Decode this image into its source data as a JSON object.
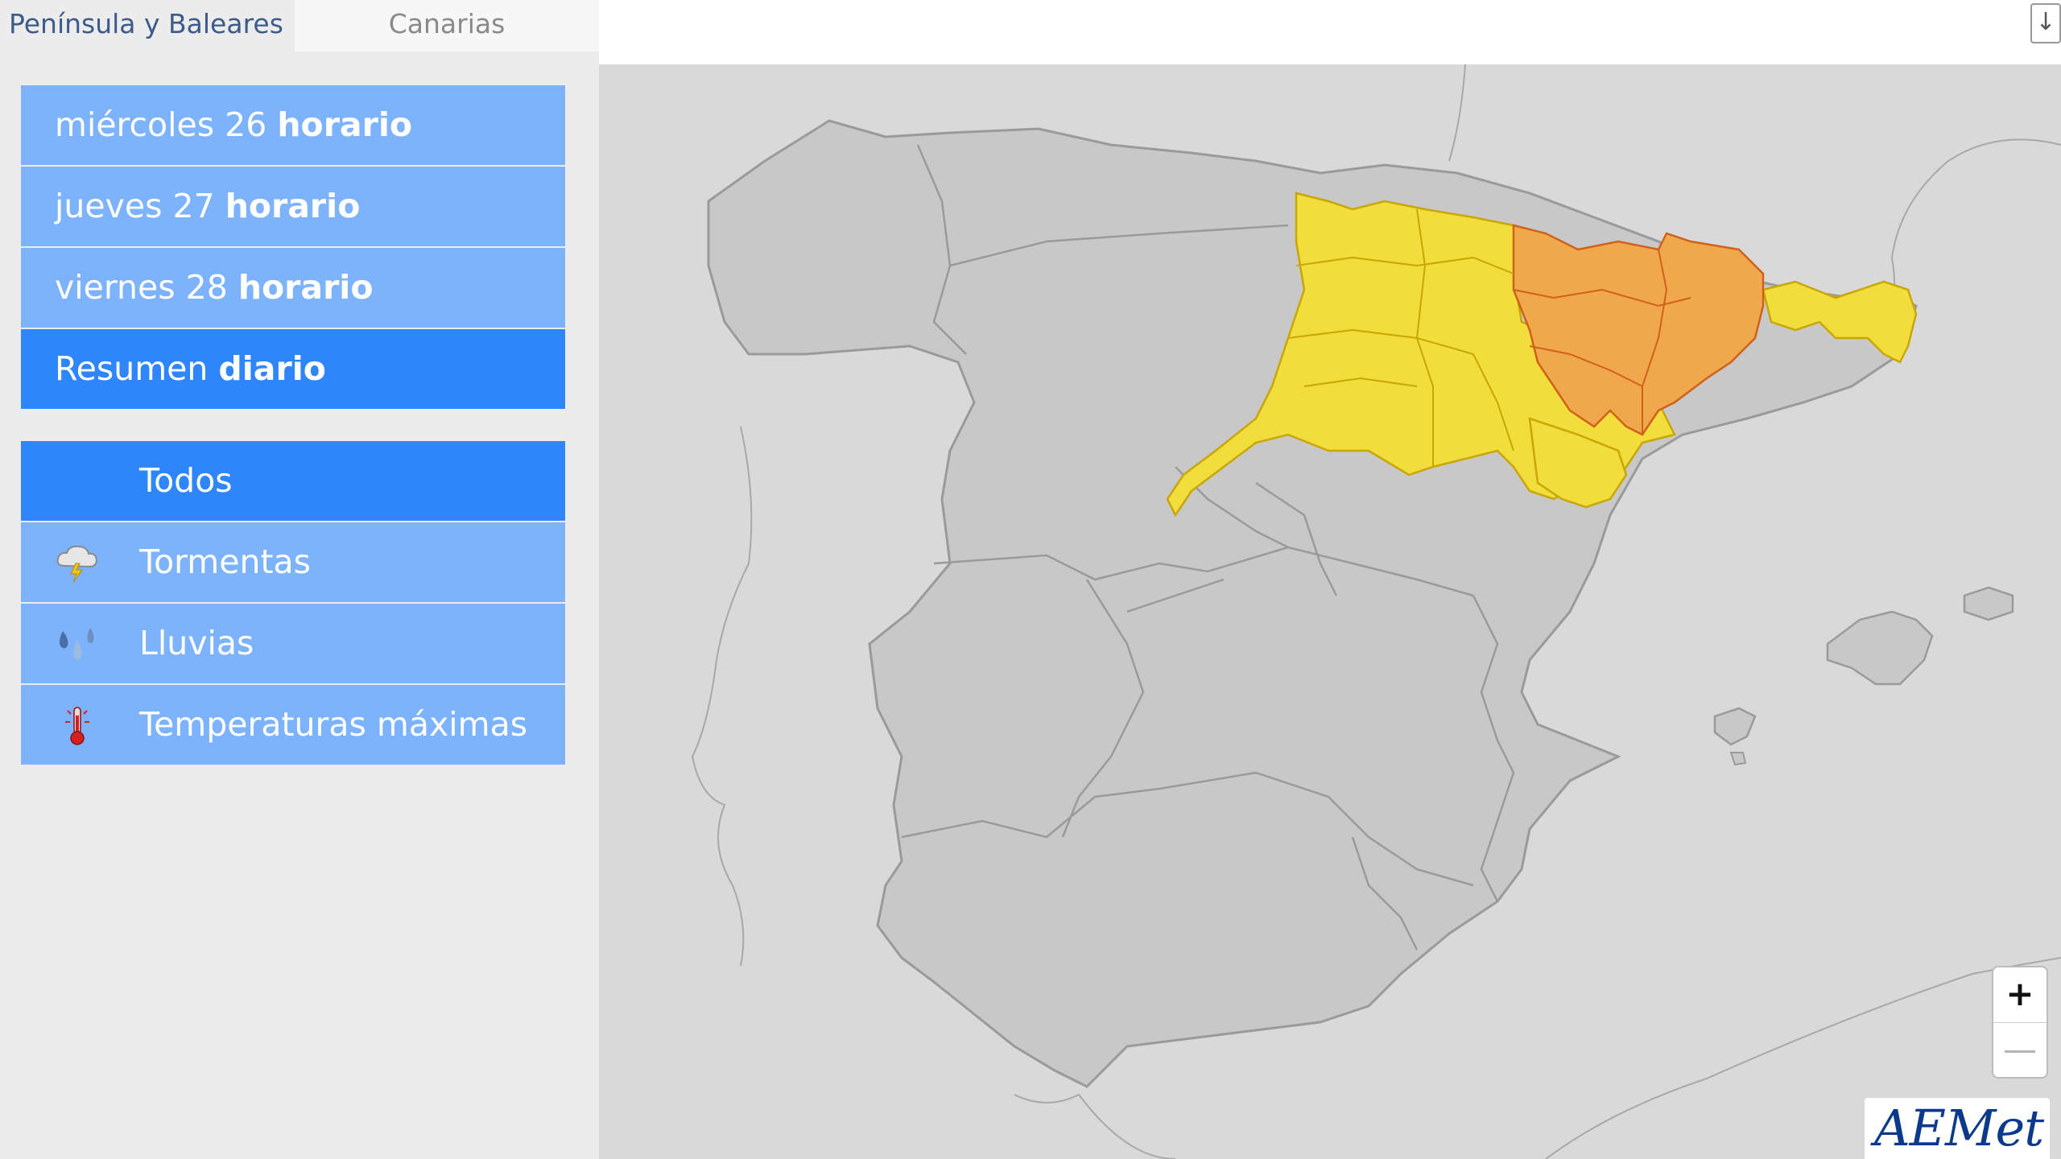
{
  "region_tabs": [
    {
      "label": "Península y Baleares",
      "active": true
    },
    {
      "label": "Canarias",
      "active": false
    }
  ],
  "day_menu": [
    {
      "prefix": "miércoles 26",
      "suffix": "horario",
      "selected": false
    },
    {
      "prefix": "jueves 27",
      "suffix": "horario",
      "selected": false
    },
    {
      "prefix": "viernes 28",
      "suffix": "horario",
      "selected": false
    },
    {
      "prefix": "Resumen",
      "suffix": "diario",
      "selected": true
    }
  ],
  "type_menu": [
    {
      "label": "Todos",
      "icon": null,
      "selected": true
    },
    {
      "label": "Tormentas",
      "icon": "storm-icon",
      "selected": false
    },
    {
      "label": "Lluvias",
      "icon": "rain-icon",
      "selected": false
    },
    {
      "label": "Temperaturas máximas",
      "icon": "thermometer-icon",
      "selected": false
    }
  ],
  "map": {
    "download_icon": "download-icon",
    "zoom_in": "+",
    "zoom_out": "—",
    "logo_text": "AEMet",
    "colors": {
      "land": "#c8c8c8",
      "sea": "#d9d9d9",
      "yellow_warning": "#f1dd3c",
      "orange_warning": "#f0a84c",
      "border": "#9a9a9a"
    }
  }
}
